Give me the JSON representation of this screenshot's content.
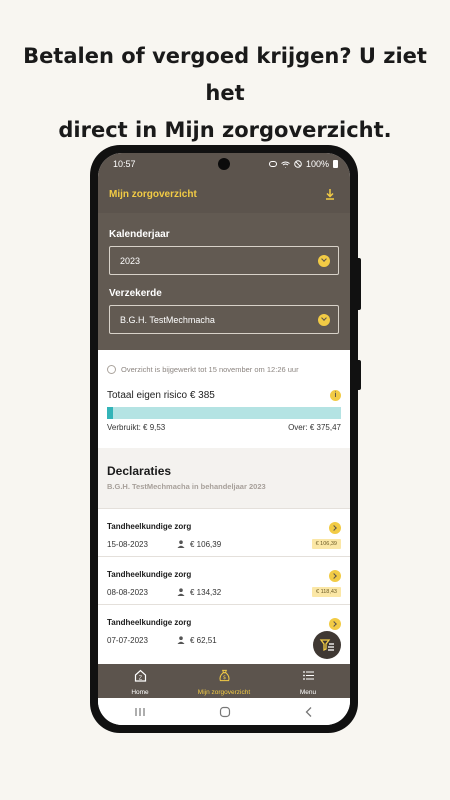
{
  "headline": {
    "line1": "Betalen of vergoed krijgen? U ziet het",
    "line2": "direct in Mijn zorgoverzicht."
  },
  "status": {
    "time": "10:57",
    "battery": "100%"
  },
  "appbar": {
    "title": "Mijn zorgoverzicht",
    "icon": "download-icon"
  },
  "filters": {
    "year_label": "Kalenderjaar",
    "year_value": "2023",
    "insured_label": "Verzekerde",
    "insured_value": "B.G.H. TestMechmacha"
  },
  "overview": {
    "updated": "Overzicht is bijgewerkt tot 15 november om 12:26 uur",
    "risk_title": "Totaal eigen risico € 385",
    "used_label": "Verbruikt: € 9,53",
    "remaining_label": "Over: € 375,47",
    "used_fraction": 0.025
  },
  "declarations": {
    "title": "Declaraties",
    "subtitle": "B.G.H. TestMechmacha in behandeljaar 2023",
    "items": [
      {
        "title": "Tandheelkundige zorg",
        "date": "15-08-2023",
        "amount": "€ 106,39",
        "badge": "€ 106,39"
      },
      {
        "title": "Tandheelkundige zorg",
        "date": "08-08-2023",
        "amount": "€ 134,32",
        "badge": "€ 118,43"
      },
      {
        "title": "Tandheelkundige zorg",
        "date": "07-07-2023",
        "amount": "€ 62,51",
        "badge": ""
      }
    ]
  },
  "bottomnav": {
    "home": "Home",
    "overview": "Mijn zorgoverzicht",
    "menu": "Menu"
  },
  "colors": {
    "brown": "#5c544d",
    "accent": "#f2cb45",
    "teal": "#33b4b8"
  }
}
